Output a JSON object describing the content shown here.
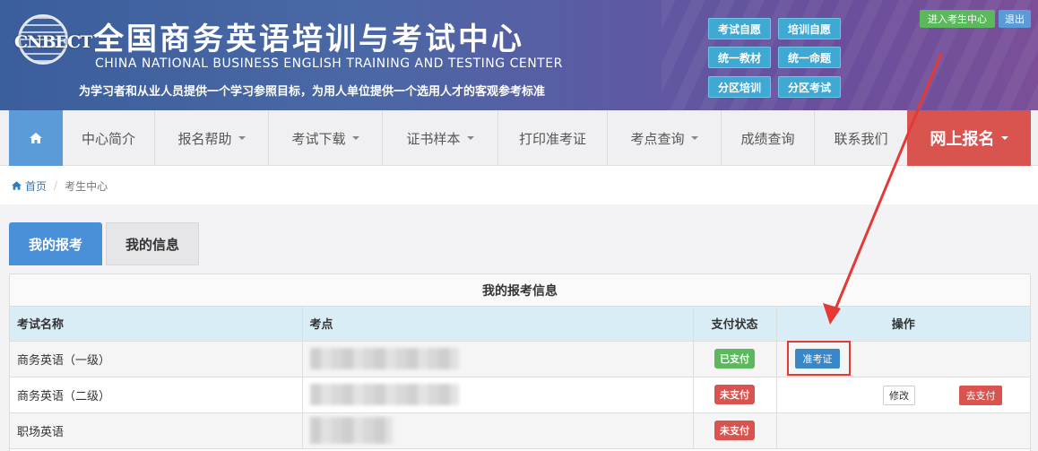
{
  "header": {
    "logo_text": "CNBECT",
    "title_cn": "全国商务英语培训与考试中心",
    "title_en": "CHINA NATIONAL BUSINESS ENGLISH TRAINING AND TESTING CENTER",
    "slogan": "为学习者和从业人员提供一个学习参照目标，为用人单位提供一个选用人才的客观参考标准",
    "quick_links": [
      "考试自愿",
      "培训自愿",
      "统一教材",
      "统一命题",
      "分区培训",
      "分区考试"
    ],
    "enter_center_label": "进入考生中心",
    "logout_label": "退出"
  },
  "nav": {
    "home_icon": "home-icon",
    "items": [
      {
        "label": "中心简介",
        "dropdown": false
      },
      {
        "label": "报名帮助",
        "dropdown": true
      },
      {
        "label": "考试下载",
        "dropdown": true
      },
      {
        "label": "证书样本",
        "dropdown": true
      },
      {
        "label": "打印准考证",
        "dropdown": false
      },
      {
        "label": "考点查询",
        "dropdown": true
      },
      {
        "label": "成绩查询",
        "dropdown": false
      },
      {
        "label": "联系我们",
        "dropdown": false
      }
    ],
    "register_label": "网上报名"
  },
  "breadcrumb": {
    "home_label": "首页",
    "current": "考生中心"
  },
  "tabs": [
    {
      "label": "我的报考",
      "active": true
    },
    {
      "label": "我的信息",
      "active": false
    }
  ],
  "panel": {
    "title": "我的报考信息",
    "columns": [
      "考试名称",
      "考点",
      "支付状态",
      "操作"
    ],
    "rows": [
      {
        "exam": "商务英语（一级）",
        "site": "",
        "status": "已支付",
        "paid": true,
        "actions": [
          "准考证"
        ]
      },
      {
        "exam": "商务英语（二级）",
        "site": "",
        "status": "未支付",
        "paid": false,
        "actions": [
          "修改",
          "去支付"
        ]
      },
      {
        "exam": "职场英语",
        "site": "",
        "status": "未支付",
        "paid": false,
        "actions": []
      }
    ]
  },
  "colors": {
    "primary": "#4a90d9",
    "danger": "#d9534f",
    "success": "#5cb85c",
    "table_header": "#d9edf7",
    "annotation": "#e53935"
  }
}
